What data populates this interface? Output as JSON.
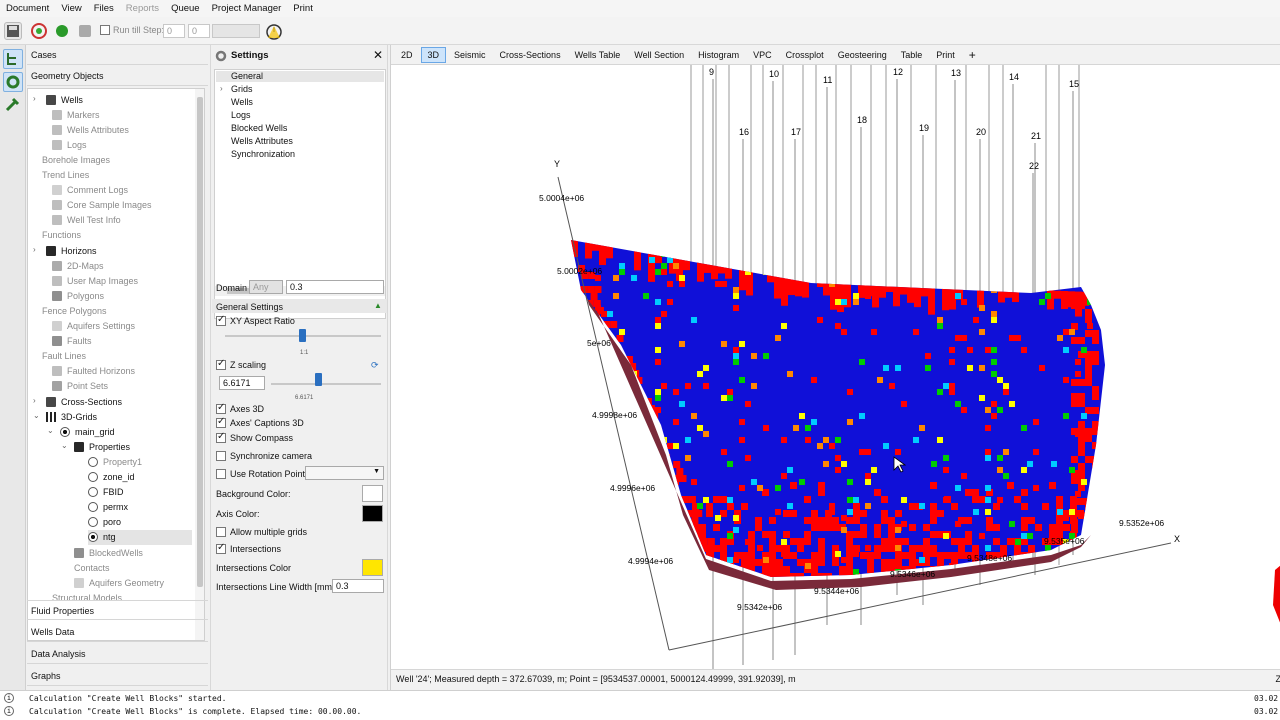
{
  "menu": [
    "Document",
    "View",
    "Files",
    "Reports",
    "Queue",
    "Project Manager",
    "Print"
  ],
  "menu_disabled": [
    "Reports"
  ],
  "toolbar": {
    "run_till_step_label": "Run till Step:",
    "spin1": "0",
    "spin2": "0"
  },
  "left": {
    "cases_label": "Cases",
    "geometry_label": "Geometry Objects",
    "tree": [
      {
        "label": "Wells",
        "dim": false
      },
      {
        "label": "Markers",
        "dim": true
      },
      {
        "label": "Wells Attributes",
        "dim": true
      },
      {
        "label": "Logs",
        "dim": true
      },
      {
        "label": "Borehole Images",
        "dim": true
      },
      {
        "label": "Trend Lines",
        "dim": true
      },
      {
        "label": "Comment Logs",
        "dim": true
      },
      {
        "label": "Core Sample Images",
        "dim": true
      },
      {
        "label": "Well Test Info",
        "dim": true
      },
      {
        "label": "Functions",
        "dim": true
      },
      {
        "label": "Horizons",
        "dim": false
      },
      {
        "label": "2D-Maps",
        "dim": true
      },
      {
        "label": "User Map Images",
        "dim": true
      },
      {
        "label": "Polygons",
        "dim": true
      },
      {
        "label": "Fence Polygons",
        "dim": true
      },
      {
        "label": "Aquifers Settings",
        "dim": true
      },
      {
        "label": "Faults",
        "dim": true
      },
      {
        "label": "Fault Lines",
        "dim": true
      },
      {
        "label": "Faulted Horizons",
        "dim": true
      },
      {
        "label": "Point Sets",
        "dim": true
      },
      {
        "label": "Cross-Sections",
        "dim": false
      },
      {
        "label": "3D-Grids",
        "dim": false
      },
      {
        "label": "main_grid",
        "dim": false
      },
      {
        "label": "Properties",
        "dim": false
      },
      {
        "label": "Property1",
        "dim": true
      },
      {
        "label": "zone_id",
        "dim": false
      },
      {
        "label": "FBID",
        "dim": false
      },
      {
        "label": "permx",
        "dim": false
      },
      {
        "label": "poro",
        "dim": false
      },
      {
        "label": "ntg",
        "dim": false
      },
      {
        "label": "BlockedWells",
        "dim": true
      },
      {
        "label": "Contacts",
        "dim": true
      },
      {
        "label": "Aquifers Geometry",
        "dim": true
      },
      {
        "label": "Structural Models",
        "dim": true
      }
    ],
    "sections": [
      "Fluid Properties",
      "Wells Data",
      "Data Analysis",
      "Graphs"
    ]
  },
  "settings": {
    "title": "Settings",
    "tree": [
      "General",
      "Grids",
      "Wells",
      "Logs",
      "Blocked Wells",
      "Wells Attributes",
      "Synchronization"
    ],
    "domain_label": "Domain",
    "domain_value": "Any",
    "domain_input": "0.3",
    "general_settings": "General Settings",
    "xy_aspect": "XY Aspect Ratio",
    "xy_tick": "1:1",
    "z_scaling": "Z scaling",
    "z_value": "6.6171",
    "z_tick": "6.6171",
    "axes3d": "Axes 3D",
    "axes_captions": "Axes' Captions 3D",
    "show_compass": "Show Compass",
    "sync_camera": "Synchronize camera",
    "use_rotation": "Use Rotation Point",
    "bg_color": "Background Color:",
    "axis_color": "Axis Color:",
    "allow_multiple": "Allow multiple grids",
    "intersections": "Intersections",
    "intersections_color": "Intersections Color",
    "intersections_width": "Intersections Line Width [mm]",
    "intersections_width_value": "0.3",
    "colors": {
      "background": "#ffffff",
      "axis": "#000000",
      "intersections": "#ffe600"
    }
  },
  "tabs": [
    "2D",
    "3D",
    "Seismic",
    "Cross-Sections",
    "Wells Table",
    "Well Section",
    "Histogram",
    "VPC",
    "Crossplot",
    "Geosteering",
    "Table",
    "Print",
    "+"
  ],
  "active_tab": "3D",
  "view3d": {
    "well_labels": [
      "9",
      "10",
      "11",
      "12",
      "13",
      "14",
      "15",
      "16",
      "17",
      "18",
      "19",
      "20",
      "21",
      "22"
    ],
    "y_axis": "Y",
    "x_axis": "X",
    "y_ticks": [
      "5.0004e+06",
      "5.0002e+06",
      "5e+06",
      "4.9998e+06",
      "4.9996e+06",
      "4.9994e+06"
    ],
    "x_ticks": [
      "9.5342e+06",
      "9.5344e+06",
      "9.5346e+06",
      "9.5348e+06",
      "9.535e+06",
      "9.5352e+06"
    ]
  },
  "status": "Well '24'; Measured depth = 372.67039, m; Point = [9534537.00001, 5000124.49999, 391.92039], m",
  "status_right": "Z",
  "log": [
    {
      "text": "Calculation \"Create Well Blocks\" started.",
      "time": "03.02."
    },
    {
      "text": "Calculation \"Create Well Blocks\" is complete. Elapsed time: 00.00.00.",
      "time": "03.02."
    }
  ]
}
